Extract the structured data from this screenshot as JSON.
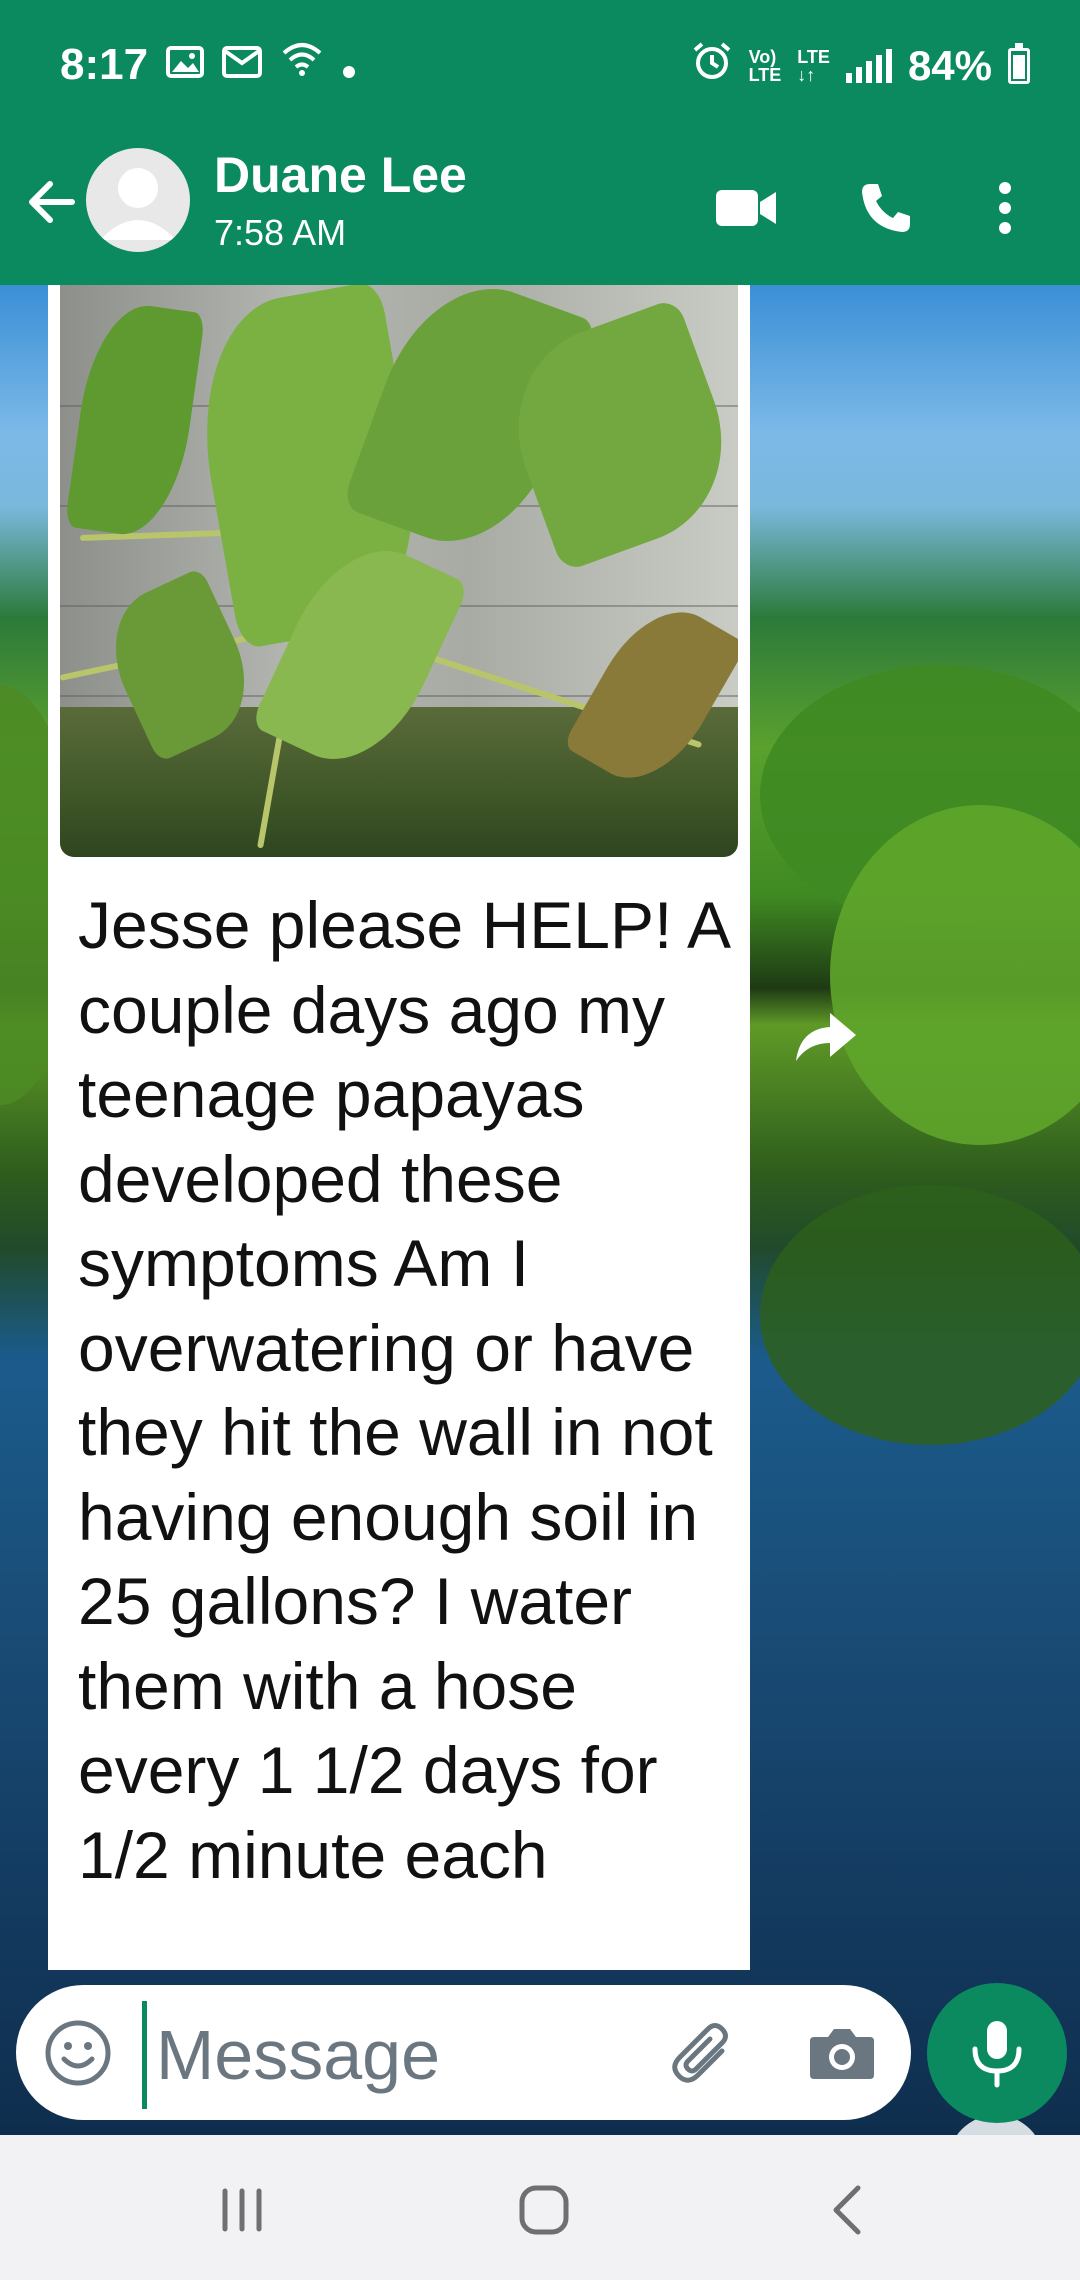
{
  "status_bar": {
    "time": "8:17",
    "battery": "84%",
    "volte": "Vo)",
    "lte_top": "LTE",
    "lte_label": "LTE",
    "icons": [
      "gallery-icon",
      "mail-icon",
      "wifi-calling-icon",
      "dot-icon",
      "alarm-icon",
      "volte-icon",
      "lte-icon",
      "signal-icon",
      "battery-icon"
    ]
  },
  "header": {
    "contact_name": "Duane Lee",
    "last_seen": "7:58 AM",
    "icons": [
      "back-arrow-icon",
      "avatar",
      "video-call-icon",
      "phone-icon",
      "more-vert-icon"
    ]
  },
  "message": {
    "text": "Jesse please HELP! A couple days ago my teenage papayas developed these symptoms Am I overwatering or have they hit the wall in not having enough soil in 25 gallons? I water them with a hose every 1 1/2 days for 1/2 minute each"
  },
  "composer": {
    "placeholder": "Message",
    "icons": [
      "emoji-icon",
      "attach-icon",
      "camera-icon",
      "mic-icon"
    ]
  },
  "colors": {
    "primary": "#0b8a5f",
    "bubble": "#ffffff",
    "text": "#111111"
  },
  "nav": {
    "icons": [
      "recents-icon",
      "home-icon",
      "back-icon"
    ]
  }
}
